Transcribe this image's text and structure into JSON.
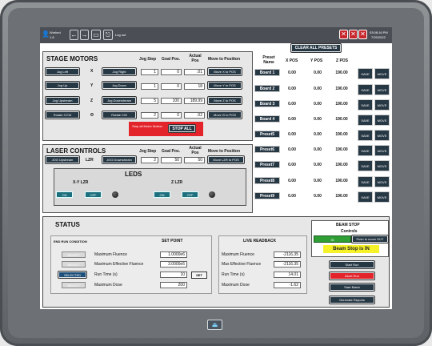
{
  "topbar": {
    "user_line1": "Worked",
    "user_line2": "1.8",
    "logout": "Log out",
    "clock_line1": "03:08:16 PM",
    "clock_line2": "7/29/2022"
  },
  "stage": {
    "title": "STAGE MOTORS",
    "col_step": "Jog Step",
    "col_goal": "Goal Pos.",
    "col_actual": "Actual Pos",
    "col_move": "Move to Position",
    "rows": [
      {
        "minus": "Jog Left",
        "axis": "X",
        "plus": "Jog Right",
        "step": "1",
        "goal": "0",
        "actual": ".01",
        "move": "Move X to POS"
      },
      {
        "minus": "Jog Up",
        "axis": "Y",
        "plus": "Jog Down",
        "step": "1",
        "goal": "0",
        "actual": "18",
        "move": "Move Y to POS"
      },
      {
        "minus": "Jog Upstream",
        "axis": "Z",
        "plus": "Jog Downstream",
        "step": "5",
        "goal": "100",
        "actual": "189.99",
        "move": "Move Z to POS"
      },
      {
        "minus": "Rotate CCW",
        "axis": "Θ",
        "plus": "Rotate CW",
        "step": "2",
        "goal": "0",
        "actual": ".02",
        "move": "Move Θ to POS"
      }
    ],
    "stop_msg": "Stop all Motor Motion",
    "stop_all": "STOP ALL"
  },
  "laser": {
    "title": "LASER CONTROLS",
    "col_step": "Jog Step",
    "col_goal": "Goal Pos.",
    "col_actual": "Actual Pos",
    "col_move": "Move to Position",
    "minus": "JOG Upstream",
    "axis": "LZR",
    "plus": "JOG Downstream",
    "step": "2",
    "goal": "50",
    "actual": "50",
    "move": "Move LZR to POS"
  },
  "leds": {
    "title": "LEDS",
    "xy_label": "X-Y LZR",
    "z_label": "Z LZR",
    "on": "ON",
    "off": "OFF"
  },
  "presets": {
    "clear": "CLEAR ALL PRESETS",
    "col_name": "Preset Name",
    "col_x": "X POS",
    "col_y": "Y POS",
    "col_z": "Z POS",
    "save": "SAVE",
    "move": "MOVE",
    "rows": [
      {
        "name": "Board 1",
        "x": "0.00",
        "y": "0.00",
        "z": "190.00"
      },
      {
        "name": "Board 2",
        "x": "0.00",
        "y": "0.00",
        "z": "190.00"
      },
      {
        "name": "Board 3",
        "x": "0.00",
        "y": "0.00",
        "z": "190.00"
      },
      {
        "name": "Board 4",
        "x": "0.00",
        "y": "0.00",
        "z": "190.00"
      },
      {
        "name": "Preset5",
        "x": "0.00",
        "y": "0.00",
        "z": "190.00"
      },
      {
        "name": "Preset6",
        "x": "0.00",
        "y": "0.00",
        "z": "190.00"
      },
      {
        "name": "Preset7",
        "x": "0.00",
        "y": "0.00",
        "z": "190.00"
      },
      {
        "name": "Preset8",
        "x": "0.00",
        "y": "0.00",
        "z": "190.00"
      },
      {
        "name": "Preset9",
        "x": "0.00",
        "y": "0.00",
        "z": "190.00"
      }
    ]
  },
  "status": {
    "title": "STATUS",
    "end_run": "END RUN CONDITION",
    "set_point": "SET POINT",
    "live": "LIVE READBACK",
    "selected": "SELECTED",
    "select": "SELECT",
    "set": "SET",
    "rows": [
      {
        "label": "Maximum Fluence",
        "setpoint": "1.0000e6",
        "live_label": "Maximum Fluence",
        "live": "-2116.35"
      },
      {
        "label": "Maximum Effective Fluence",
        "setpoint": "3.0000e5",
        "live_label": "Max Effective Fluence",
        "live": "-2116.35"
      },
      {
        "label": "Run Time (s)",
        "setpoint": "10",
        "live_label": "Run Time (s)",
        "live": "14.01"
      },
      {
        "label": "Maximum Dose",
        "setpoint": "200",
        "live_label": "Maximum Dose",
        "live": "-1.62"
      }
    ]
  },
  "beam": {
    "title": "BEAM STOP",
    "subtitle": "Controls",
    "in": "IN",
    "push_out": "Push to move OUT",
    "state": "Beam Stop is IN"
  },
  "actions": {
    "start": "Start Run",
    "abort": "Abort Run",
    "batch": "Start Batch",
    "reports": "Generate Reports"
  },
  "colors": {
    "dark_button": "#273845",
    "stop": "#e3242b",
    "green": "#2f9e35",
    "teal": "#1d6f7d"
  }
}
